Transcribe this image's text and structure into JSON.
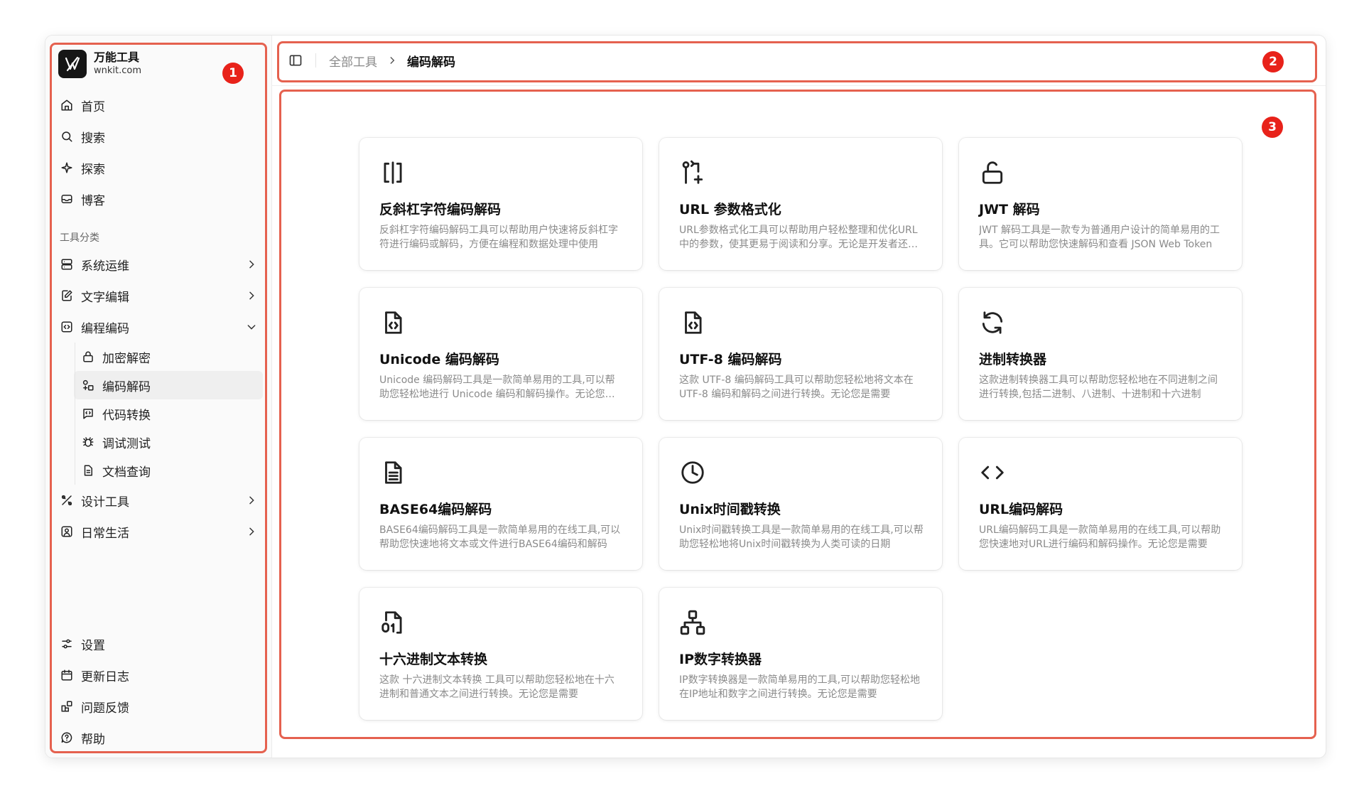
{
  "brand": {
    "name": "万能工具",
    "url": "wnkit.com"
  },
  "nav_top": [
    {
      "label": "首页",
      "icon": "home-icon"
    },
    {
      "label": "搜索",
      "icon": "search-icon"
    },
    {
      "label": "探索",
      "icon": "sparkle-icon"
    },
    {
      "label": "博客",
      "icon": "inbox-icon"
    }
  ],
  "category_label": "工具分类",
  "categories": [
    {
      "label": "系统运维",
      "icon": "server-icon",
      "expanded": false
    },
    {
      "label": "文字编辑",
      "icon": "edit-icon",
      "expanded": false
    },
    {
      "label": "编程编码",
      "icon": "code-box-icon",
      "expanded": true
    },
    {
      "label": "设计工具",
      "icon": "design-icon",
      "expanded": false
    },
    {
      "label": "日常生活",
      "icon": "life-icon",
      "expanded": false
    }
  ],
  "subcategories": [
    {
      "label": "加密解密",
      "icon": "lock-icon",
      "active": false
    },
    {
      "label": "编码解码",
      "icon": "shapes-icon",
      "active": true
    },
    {
      "label": "代码转换",
      "icon": "message-code-icon",
      "active": false
    },
    {
      "label": "调试测试",
      "icon": "bug-icon",
      "active": false
    },
    {
      "label": "文档查询",
      "icon": "document-icon",
      "active": false
    }
  ],
  "nav_bottom": [
    {
      "label": "设置",
      "icon": "settings-icon"
    },
    {
      "label": "更新日志",
      "icon": "calendar-icon"
    },
    {
      "label": "问题反馈",
      "icon": "feedback-icon"
    },
    {
      "label": "帮助",
      "icon": "help-icon"
    }
  ],
  "breadcrumb": {
    "parent": "全部工具",
    "current": "编码解码"
  },
  "tools": [
    {
      "title": "反斜杠字符编码解码",
      "desc": "反斜杠字符编码解码工具可以帮助用户快速将反斜杠字符进行编码或解码，方便在编程和数据处理中使用",
      "icon": "brackets-icon"
    },
    {
      "title": "URL 参数格式化",
      "desc": "URL参数格式化工具可以帮助用户轻松整理和优化URL中的参数，使其更易于阅读和分享。无论是开发者还是普通用户",
      "icon": "git-pull-icon"
    },
    {
      "title": "JWT 解码",
      "desc": "JWT 解码工具是一款专为普通用户设计的简单易用的工具。它可以帮助您快速解码和查看 JSON Web Token",
      "icon": "unlock-icon"
    },
    {
      "title": "Unicode 编码解码",
      "desc": "Unicode 编码解码工具是一款简单易用的工具,可以帮助您轻松地进行 Unicode 编码和解码操作。无论您是需要",
      "icon": "file-code-icon"
    },
    {
      "title": "UTF-8 编码解码",
      "desc": "这款 UTF-8 编码解码工具可以帮助您轻松地将文本在 UTF-8 编码和解码之间进行转换。无论您是需要",
      "icon": "file-code-icon"
    },
    {
      "title": "进制转换器",
      "desc": "这款进制转换器工具可以帮助您轻松地在不同进制之间进行转换,包括二进制、八进制、十进制和十六进制",
      "icon": "refresh-icon"
    },
    {
      "title": "BASE64编码解码",
      "desc": "BASE64编码解码工具是一款简单易用的在线工具,可以帮助您快速地将文本或文件进行BASE64编码和解码",
      "icon": "file-text-icon"
    },
    {
      "title": "Unix时间戳转换",
      "desc": "Unix时间戳转换工具是一款简单易用的在线工具,可以帮助您轻松地将Unix时间戳转换为人类可读的日期",
      "icon": "clock-icon"
    },
    {
      "title": "URL编码解码",
      "desc": "URL编码解码工具是一款简单易用的在线工具,可以帮助您快速地对URL进行编码和解码操作。无论您是需要",
      "icon": "code-icon"
    },
    {
      "title": "十六进制文本转换",
      "desc": "这款 十六进制文本转换 工具可以帮助您轻松地在十六进制和普通文本之间进行转换。无论您是需要",
      "icon": "file-digit-icon"
    },
    {
      "title": "IP数字转换器",
      "desc": "IP数字转换器是一款简单易用的工具,可以帮助您轻松地在IP地址和数字之间进行转换。无论您是需要",
      "icon": "network-icon"
    }
  ],
  "annotations": [
    "1",
    "2",
    "3"
  ],
  "accent_color": "#e8221a"
}
